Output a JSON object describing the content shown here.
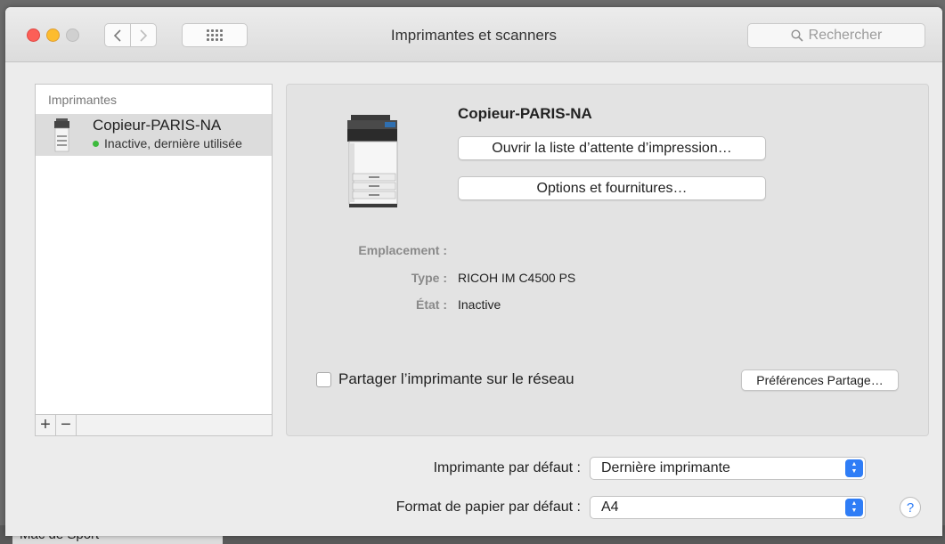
{
  "window": {
    "title": "Imprimantes et scanners",
    "search_placeholder": "Rechercher"
  },
  "printers_list": {
    "header": "Imprimantes",
    "items": [
      {
        "name": "Copieur-PARIS-NA",
        "status": "Inactive, dernière utilisée",
        "status_color": "#3dba3d"
      }
    ],
    "add_label": "+",
    "remove_label": "−"
  },
  "detail": {
    "name": "Copieur-PARIS-NA",
    "open_queue_label": "Ouvrir la liste d’attente d’impression…",
    "options_label": "Options et fournitures…",
    "location_label": "Emplacement :",
    "location_value": "",
    "type_label": "Type :",
    "type_value": "RICOH IM C4500 PS",
    "state_label": "État :",
    "state_value": "Inactive",
    "share_label": "Partager l’imprimante sur le réseau",
    "share_checked": false,
    "share_prefs_label": "Préférences Partage…"
  },
  "defaults": {
    "default_printer_label": "Imprimante par défaut :",
    "default_printer_value": "Dernière imprimante",
    "paper_label": "Format de papier par défaut :",
    "paper_value": "A4"
  },
  "help_label": "?",
  "background_window_text": "Mac de Sport",
  "colors": {
    "accent": "#2f7df6",
    "close": "#fc5f57",
    "minimize": "#fdbc2e",
    "status_ok": "#3dba3d"
  }
}
